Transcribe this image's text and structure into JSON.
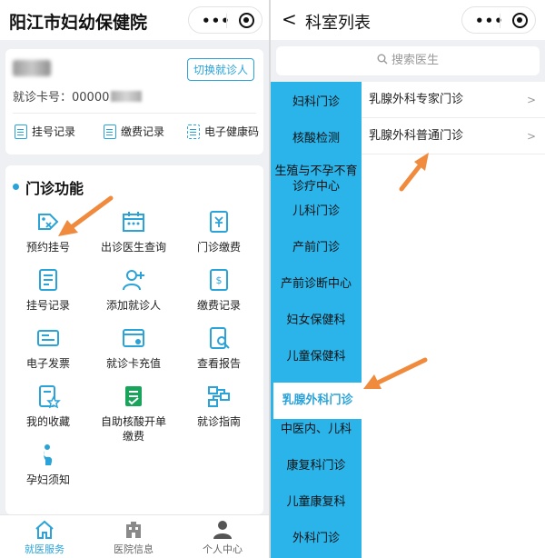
{
  "left": {
    "app_title": "阳江市妇幼保健院",
    "switch_patient": "切换就诊人",
    "card_no_prefix": "就诊卡号：00000",
    "quick_links": [
      "挂号记录",
      "缴费记录",
      "电子健康码"
    ],
    "section_title": "门诊功能",
    "functions": [
      {
        "label": "预约挂号",
        "icon": "tag-icon"
      },
      {
        "label": "出诊医生查询",
        "icon": "calendar-icon"
      },
      {
        "label": "门诊缴费",
        "icon": "yuan-doc-icon"
      },
      {
        "label": "挂号记录",
        "icon": "record-icon"
      },
      {
        "label": "添加就诊人",
        "icon": "add-user-icon"
      },
      {
        "label": "缴费记录",
        "icon": "bill-icon"
      },
      {
        "label": "电子发票",
        "icon": "invoice-icon"
      },
      {
        "label": "就诊卡充值",
        "icon": "card-topup-icon"
      },
      {
        "label": "查看报告",
        "icon": "report-search-icon"
      },
      {
        "label": "我的收藏",
        "icon": "favorite-doc-icon"
      },
      {
        "label": "自助核酸开单缴费",
        "icon": "nucleic-test-icon"
      },
      {
        "label": "就诊指南",
        "icon": "flow-guide-icon"
      },
      {
        "label": "孕妇须知",
        "icon": "pregnant-icon"
      }
    ],
    "tabs": [
      {
        "label": "就医服务",
        "active": true
      },
      {
        "label": "医院信息",
        "active": false
      },
      {
        "label": "个人中心",
        "active": false
      }
    ]
  },
  "right": {
    "back": "<",
    "title": "科室列表",
    "search_placeholder": "搜索医生",
    "departments": [
      "妇科门诊",
      "核酸检测",
      "生殖与不孕不育诊疗中心",
      "儿科门诊",
      "产前门诊",
      "产前诊断中心",
      "妇女保健科",
      "儿童保健科",
      "乳腺外科门诊",
      "中医内、儿科",
      "康复科门诊",
      "儿童康复科",
      "外科门诊"
    ],
    "active_department": "乳腺外科门诊",
    "sub_departments": [
      "乳腺外科专家门诊",
      "乳腺外科普通门诊"
    ],
    "chevron": ">"
  },
  "colors": {
    "accent": "#2aa3d9",
    "sidebar": "#2ab4ea",
    "arrow": "#f08a3c"
  }
}
